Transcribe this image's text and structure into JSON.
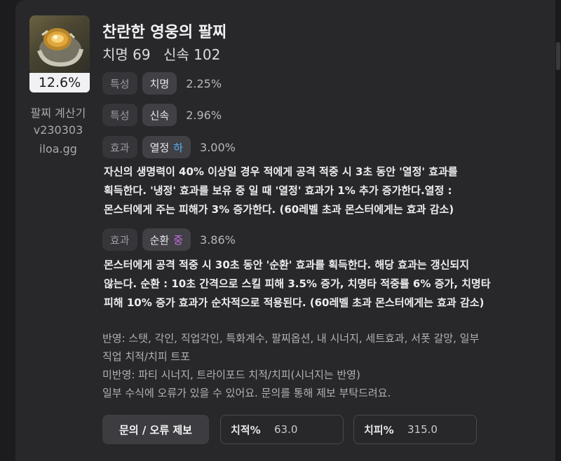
{
  "item": {
    "quality_pct": "12.6%",
    "title": "찬란한 영웅의 팔찌",
    "stat1": "치명 69",
    "stat2": "신속 102"
  },
  "sidebar": {
    "line1": "팔찌 계산기",
    "line2": "v230303",
    "line3": "iloa.gg"
  },
  "rows": [
    {
      "tag": "특성",
      "name": "치명",
      "grade": "",
      "value": "2.25%"
    },
    {
      "tag": "특성",
      "name": "신속",
      "grade": "",
      "value": "2.96%"
    },
    {
      "tag": "효과",
      "name": "열정",
      "grade": "하",
      "value": "3.00%",
      "grade_color": "#5aaef5",
      "desc": [
        "자신의 생명력이 40% 이상일 경우 적에게 공격 적중 시 3초 동안 '열정' 효과를",
        "획득한다. '냉정' 효과를 보유 중 일 때 '열정' 효과가 1% 추가 증가한다.열정 :",
        "몬스터에게 주는 피해가 3% 증가한다. (60레벨 초과 몬스터에게는 효과 감소)"
      ]
    },
    {
      "tag": "효과",
      "name": "순환",
      "grade": "중",
      "value": "3.86%",
      "grade_color": "#c46ee6",
      "desc": [
        "몬스터에게 공격 적중 시 30초 동안 '순환' 효과를 획득한다. 해당 효과는 갱신되지",
        "않는다. 순환 : 10초 간격으로 스킬 피해 3.5% 증가, 치명타 적중률 6% 증가, 치명타",
        "피해 10% 증가 효과가 순차적으로 적용된다. (60레벨 초과 몬스터에게는 효과 감소)"
      ]
    }
  ],
  "notes": [
    "반영: 스탯, 각인, 직업각인, 특화계수, 팔찌옵션, 내 시너지, 세트효과, 서폿 갈망, 일부",
    "직업 치적/치피 트포",
    "미반영: 파티 시너지, 트라이포드 치적/치피(시너지는 반영)",
    "일부 수식에 오류가 있을 수 있어요. 문의를 통해 제보 부탁드려요."
  ],
  "controls": {
    "report_button": "문의 / 오류 제보",
    "crit_label": "치적%",
    "crit_value": "63.0",
    "critdmg_label": "치피%",
    "critdmg_value": "315.0"
  }
}
